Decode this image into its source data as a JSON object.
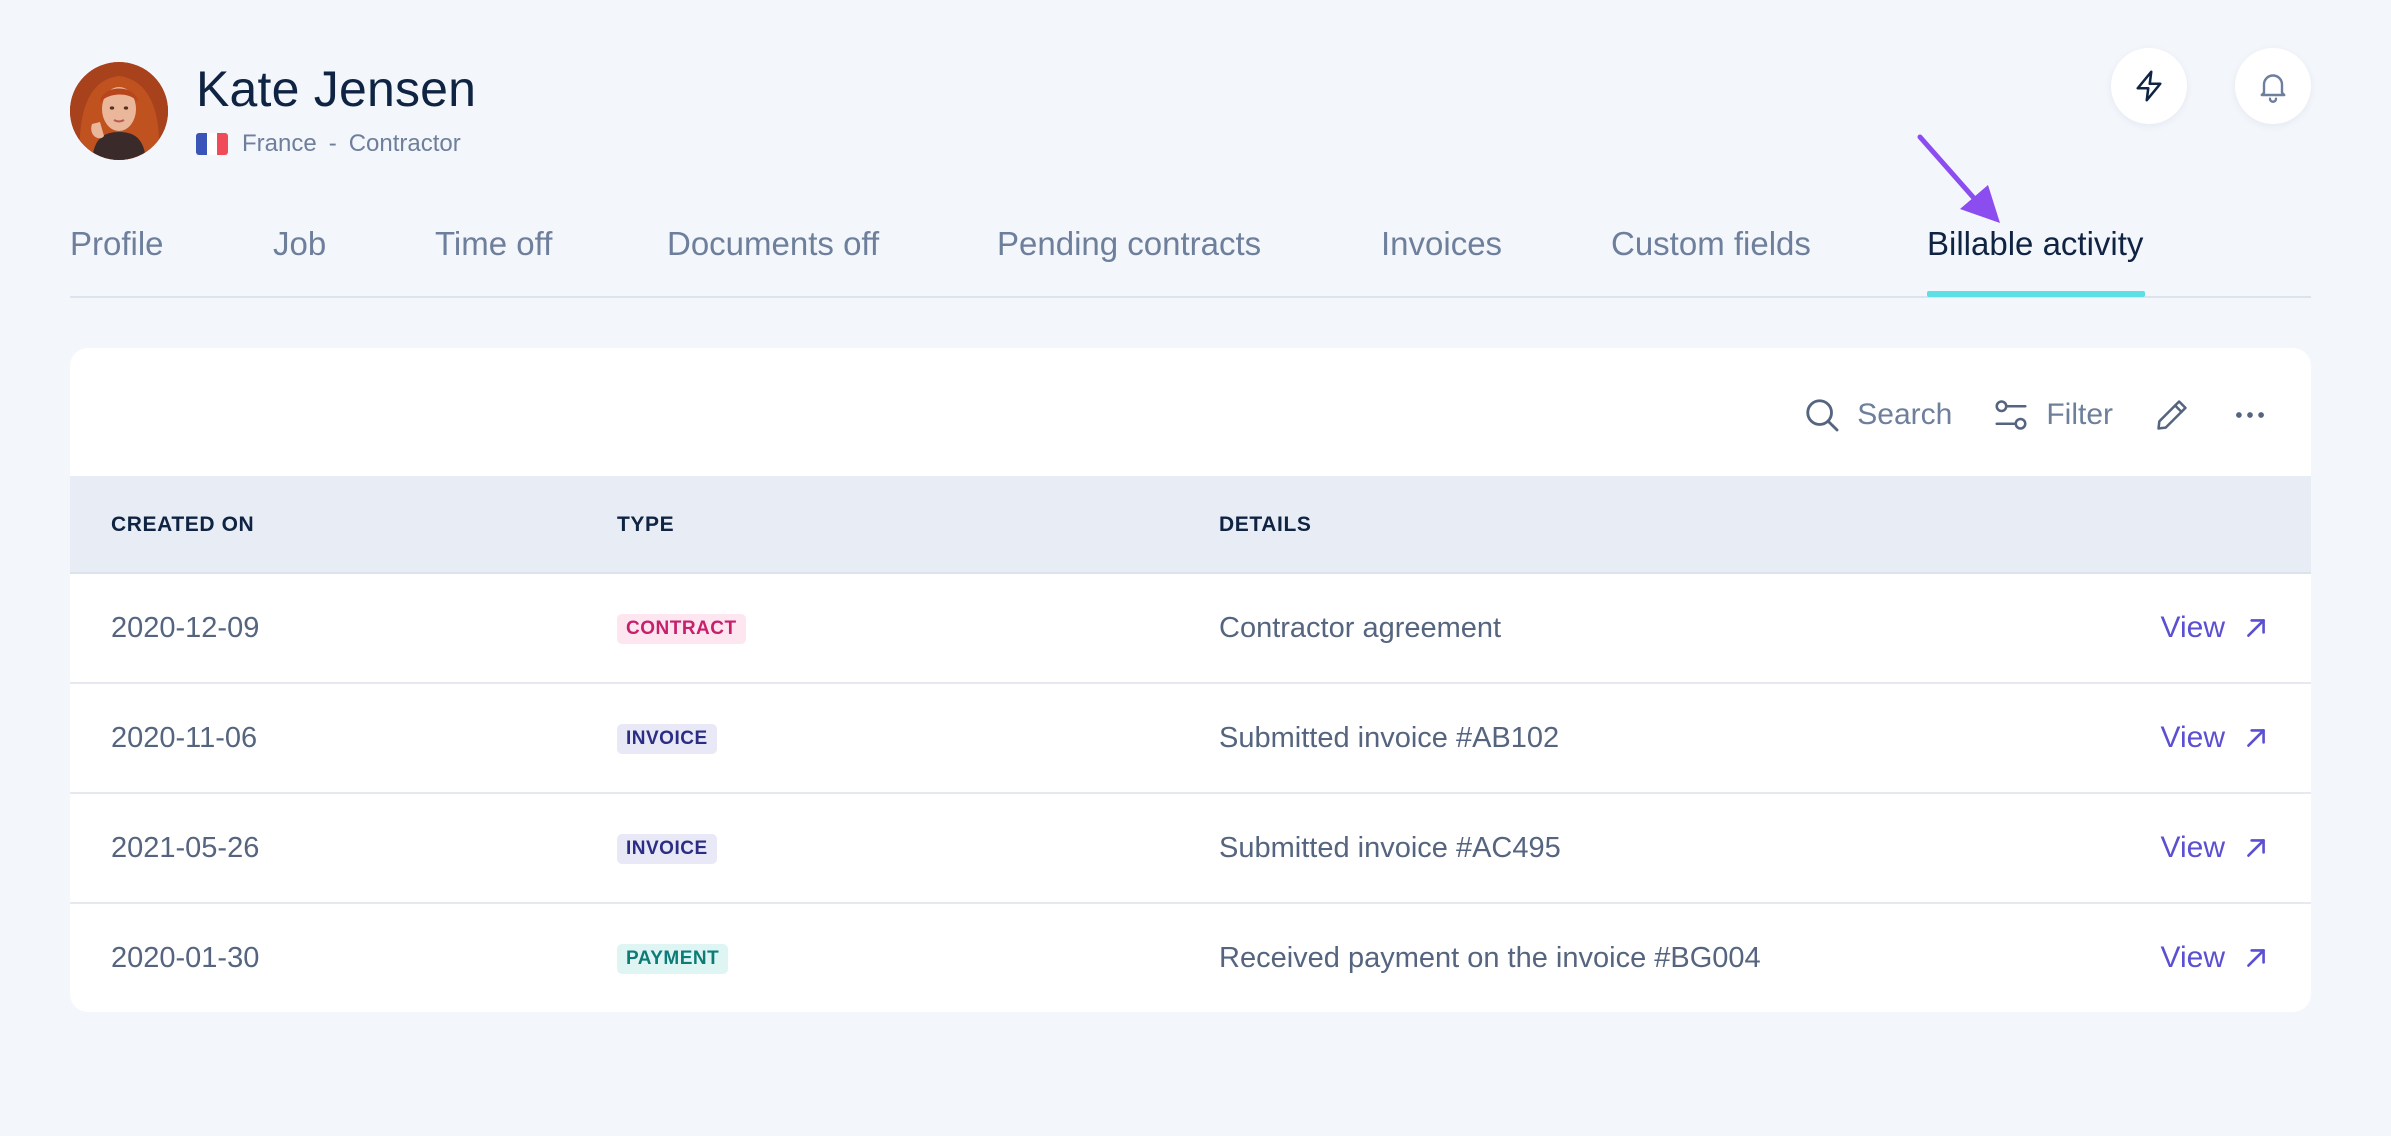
{
  "profile": {
    "name": "Kate Jensen",
    "country": "France",
    "separator": "-",
    "role": "Contractor"
  },
  "header_actions": [
    {
      "icon": "lightning-bolt-icon"
    },
    {
      "icon": "bell-icon"
    }
  ],
  "tabs": [
    {
      "label": "Profile"
    },
    {
      "label": "Job"
    },
    {
      "label": "Time off"
    },
    {
      "label": "Documents off"
    },
    {
      "label": "Pending contracts"
    },
    {
      "label": "Invoices"
    },
    {
      "label": "Custom fields"
    },
    {
      "label": "Billable activity",
      "active": true
    }
  ],
  "toolbar": {
    "search_label": "Search",
    "filter_label": "Filter",
    "edit_icon": "pencil-icon",
    "more_icon": "more-horizontal-icon"
  },
  "table": {
    "columns": [
      "CREATED ON",
      "TYPE",
      "DETAILS"
    ],
    "rows": [
      {
        "created_on": "2020-12-09",
        "type": "CONTRACT",
        "details": "Contractor agreement",
        "action": "View"
      },
      {
        "created_on": "2020-11-06",
        "type": "INVOICE",
        "details": "Submitted invoice #AB102",
        "action": "View"
      },
      {
        "created_on": "2021-05-26",
        "type": "INVOICE",
        "details": "Submitted invoice #AC495",
        "action": "View"
      },
      {
        "created_on": "2020-01-30",
        "type": "PAYMENT",
        "details": "Received payment on the invoice #BG004",
        "action": "View"
      }
    ]
  },
  "colors": {
    "accent": "#5b4fd2",
    "active_tab_underline": "#5ddfe6",
    "annotation_arrow": "#8b4cf0",
    "contract_badge": "#c81f6c",
    "invoice_badge": "#2b2d84",
    "payment_badge": "#0d7c77"
  }
}
